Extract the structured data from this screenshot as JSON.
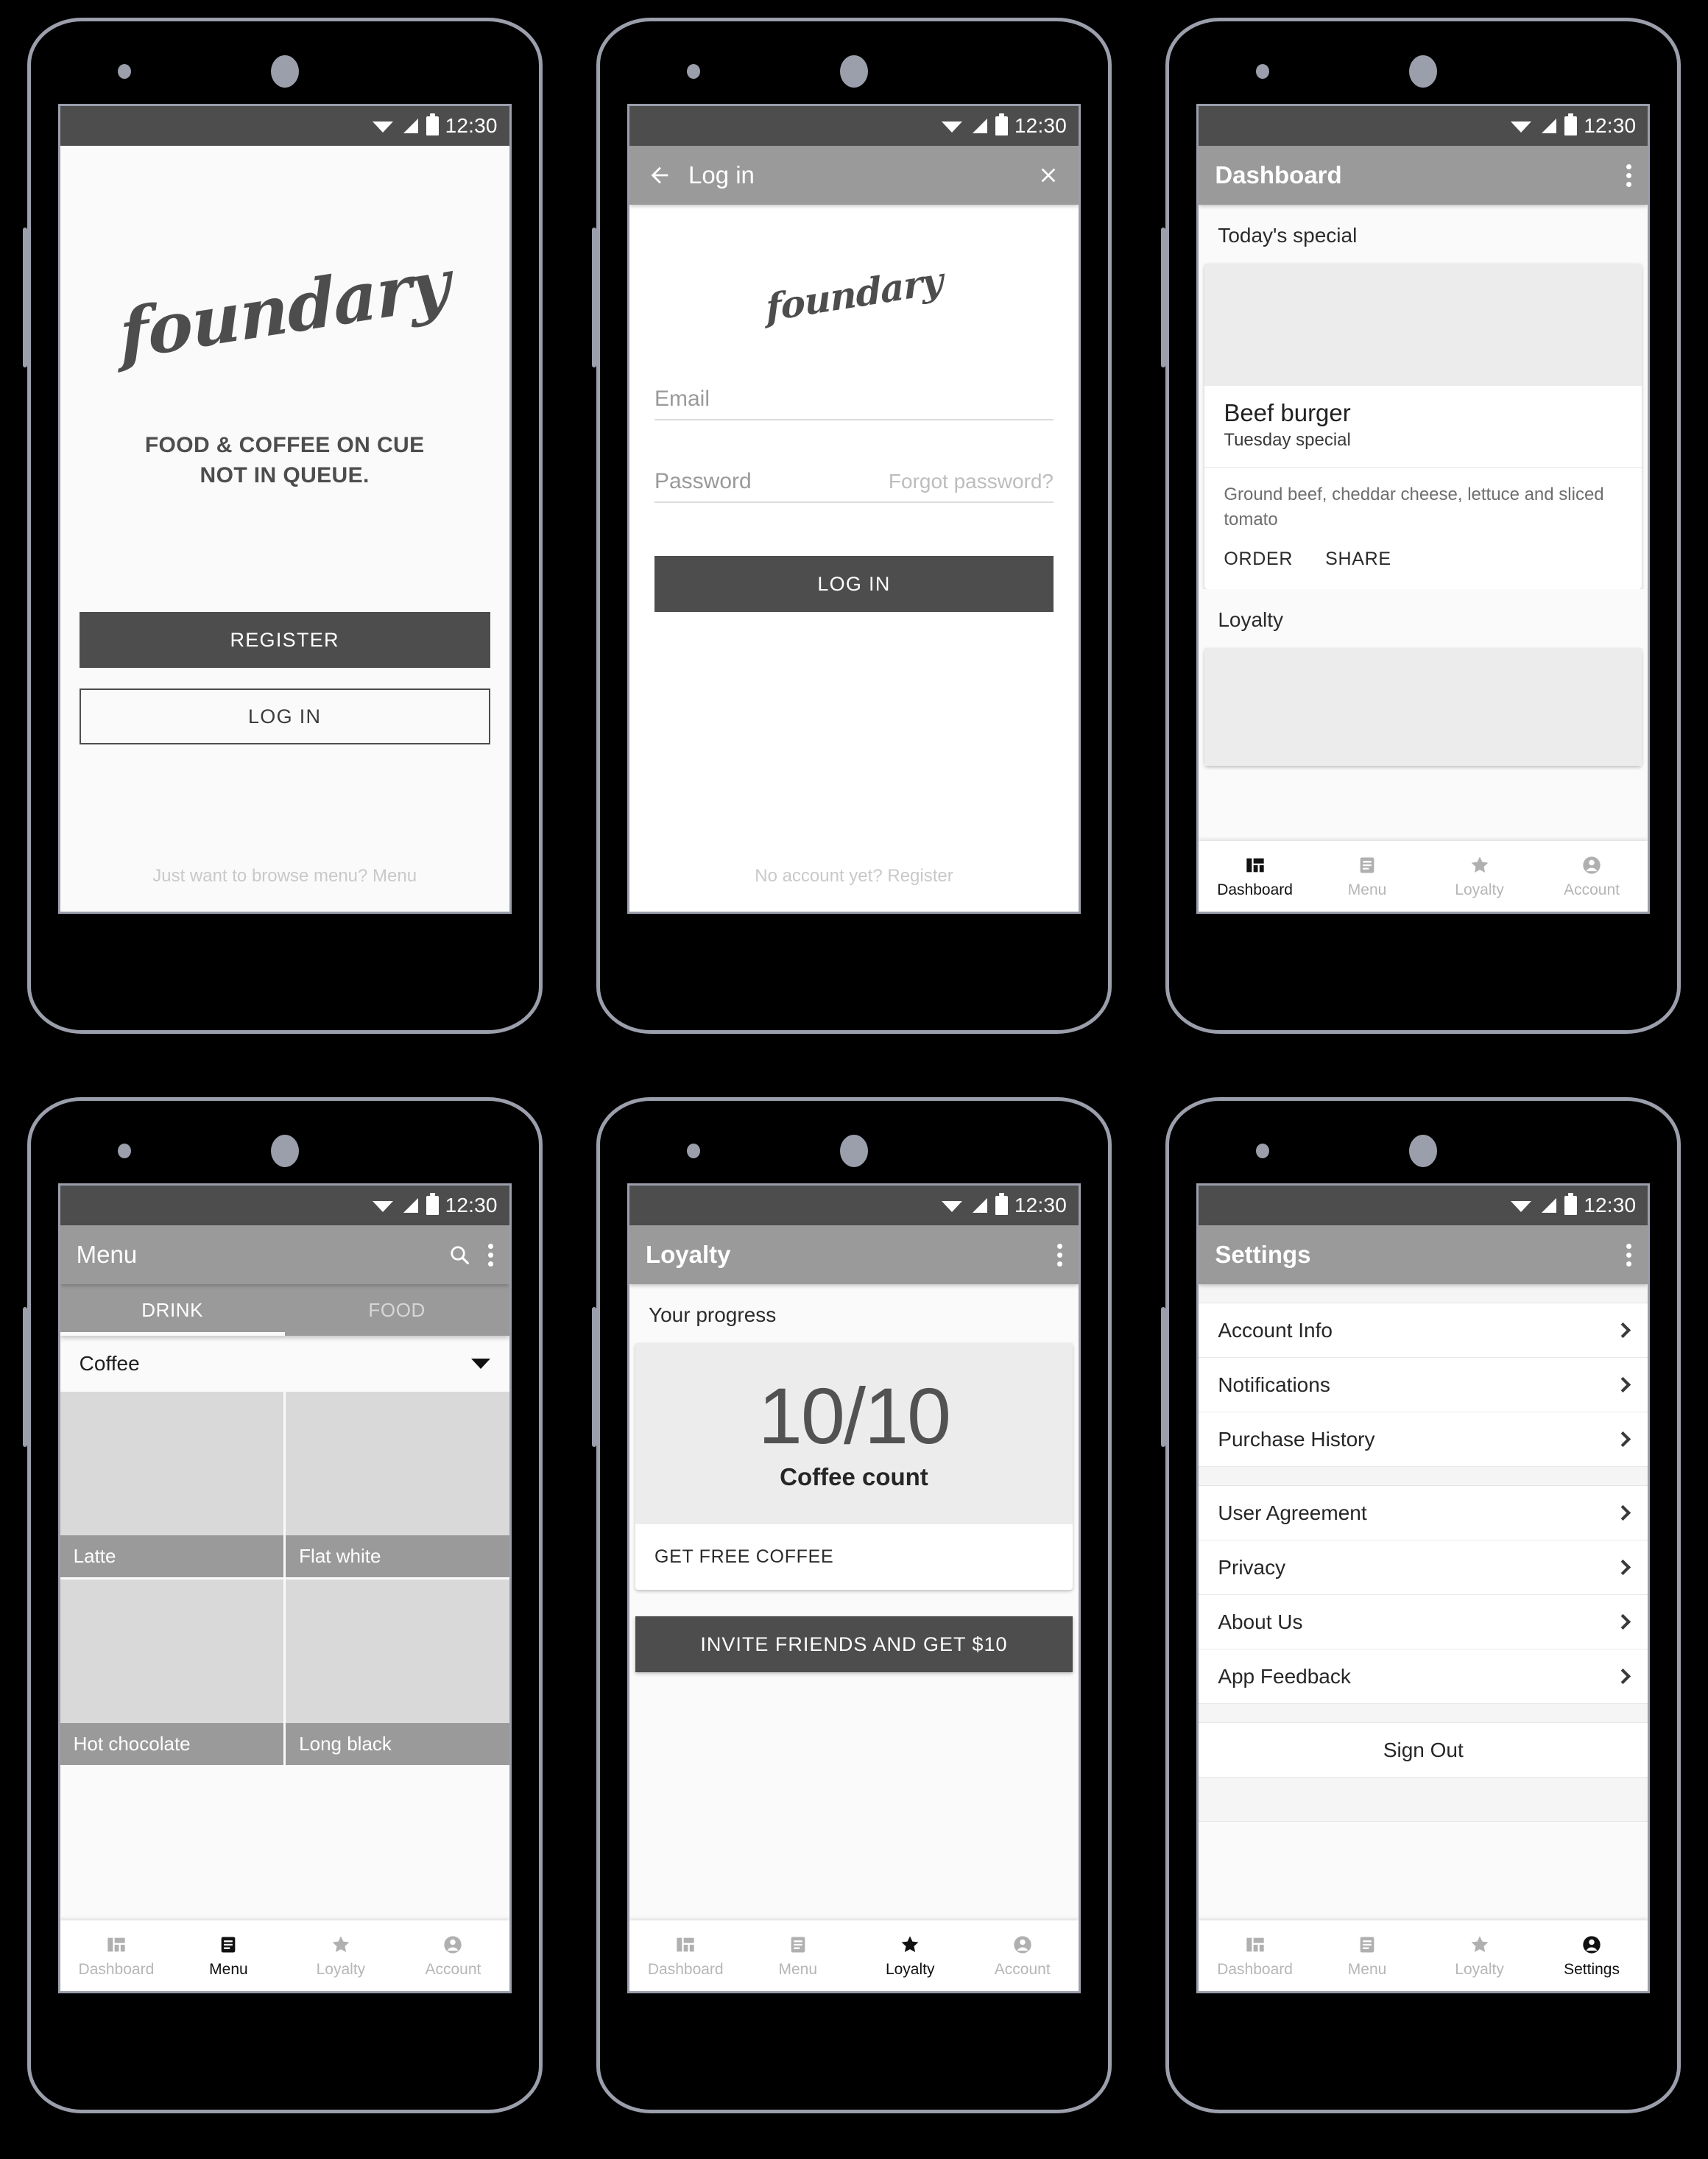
{
  "status_bar": {
    "time": "12:30",
    "icons": [
      "wifi-icon",
      "signal-icon",
      "battery-icon"
    ]
  },
  "brand": {
    "logo_text": "foundary",
    "accent": "#4d4d4d",
    "appbar": "#9a9a9a"
  },
  "screens": {
    "welcome": {
      "tagline_line1": "FOOD & COFFEE ON CUE",
      "tagline_line2": "NOT IN QUEUE.",
      "register_label": "REGISTER",
      "login_label": "LOG IN",
      "browse_note": "Just want to browse menu? Menu"
    },
    "login": {
      "title": "Log in",
      "back_icon": "back-arrow-icon",
      "close_icon": "close-icon",
      "email_label": "Email",
      "password_label": "Password",
      "forgot_label": "Forgot password?",
      "submit_label": "LOG IN",
      "register_note": "No account yet? Register"
    },
    "dashboard": {
      "title": "Dashboard",
      "overflow_icon": "more-vert-icon",
      "section_special": "Today's special",
      "card": {
        "title": "Beef burger",
        "subtitle": "Tuesday special",
        "description": "Ground beef, cheddar cheese, lettuce and sliced tomato",
        "action_order": "ORDER",
        "action_share": "SHARE"
      },
      "section_loyalty": "Loyalty"
    },
    "menu": {
      "title": "Menu",
      "search_icon": "search-icon",
      "overflow_icon": "more-vert-icon",
      "tabs": [
        {
          "label": "DRINK",
          "active": true
        },
        {
          "label": "FOOD",
          "active": false
        }
      ],
      "category": "Coffee",
      "category_caret": "chevron-down-icon",
      "items": [
        "Latte",
        "Flat white",
        "Hot chocolate",
        "Long black"
      ]
    },
    "loyalty": {
      "title": "Loyalty",
      "overflow_icon": "more-vert-icon",
      "section": "Your progress",
      "count": "10/10",
      "count_label": "Coffee count",
      "redeem_label": "GET FREE COFFEE",
      "invite_label": "INVITE FRIENDS AND GET $10"
    },
    "settings": {
      "title": "Settings",
      "overflow_icon": "more-vert-icon",
      "group1": [
        "Account Info",
        "Notifications",
        "Purchase History"
      ],
      "group2": [
        "User Agreement",
        "Privacy",
        "About Us",
        "App Feedback"
      ],
      "sign_out": "Sign Out"
    }
  },
  "bottom_nav": {
    "dashboard": [
      {
        "label": "Dashboard",
        "icon": "dashboard-icon",
        "active": true
      },
      {
        "label": "Menu",
        "icon": "menu-list-icon",
        "active": false
      },
      {
        "label": "Loyalty",
        "icon": "star-icon",
        "active": false
      },
      {
        "label": "Account",
        "icon": "account-icon",
        "active": false
      }
    ],
    "menu": [
      {
        "label": "Dashboard",
        "icon": "dashboard-icon",
        "active": false
      },
      {
        "label": "Menu",
        "icon": "menu-list-icon",
        "active": true
      },
      {
        "label": "Loyalty",
        "icon": "star-icon",
        "active": false
      },
      {
        "label": "Account",
        "icon": "account-icon",
        "active": false
      }
    ],
    "loyalty": [
      {
        "label": "Dashboard",
        "icon": "dashboard-icon",
        "active": false
      },
      {
        "label": "Menu",
        "icon": "menu-list-icon",
        "active": false
      },
      {
        "label": "Loyalty",
        "icon": "star-icon",
        "active": true
      },
      {
        "label": "Account",
        "icon": "account-icon",
        "active": false
      }
    ],
    "settings": [
      {
        "label": "Dashboard",
        "icon": "dashboard-icon",
        "active": false
      },
      {
        "label": "Menu",
        "icon": "menu-list-icon",
        "active": false
      },
      {
        "label": "Loyalty",
        "icon": "star-icon",
        "active": false
      },
      {
        "label": "Settings",
        "icon": "account-icon",
        "active": true
      }
    ]
  }
}
